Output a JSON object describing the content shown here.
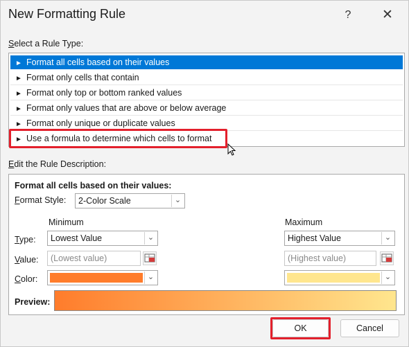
{
  "window": {
    "title": "New Formatting Rule",
    "help_glyph": "?",
    "close_glyph": "✕"
  },
  "rule_type": {
    "label": "Select a Rule Type:",
    "items": [
      {
        "label": "Format all cells based on their values",
        "selected": true
      },
      {
        "label": "Format only cells that contain",
        "selected": false
      },
      {
        "label": "Format only top or bottom ranked values",
        "selected": false
      },
      {
        "label": "Format only values that are above or below average",
        "selected": false
      },
      {
        "label": "Format only unique or duplicate values",
        "selected": false
      },
      {
        "label": "Use a formula to determine which cells to format",
        "selected": false
      }
    ],
    "arrow_glyph": "►"
  },
  "description": {
    "label": "Edit the Rule Description:",
    "heading": "Format all cells based on their values:",
    "format_style_label": "Format Style:",
    "format_style_value": "2-Color Scale",
    "minimum_heading": "Minimum",
    "maximum_heading": "Maximum",
    "type_label": "Type:",
    "value_label": "Value:",
    "color_label": "Color:",
    "min_type": "Lowest Value",
    "max_type": "Highest Value",
    "min_value_placeholder": "(Lowest value)",
    "max_value_placeholder": "(Highest value)",
    "min_color": "#ff7c2b",
    "max_color": "#ffe68e",
    "preview_label": "Preview:"
  },
  "buttons": {
    "ok": "OK",
    "cancel": "Cancel"
  },
  "colors": {
    "selection": "#0078d7",
    "highlight": "#e3202c"
  }
}
